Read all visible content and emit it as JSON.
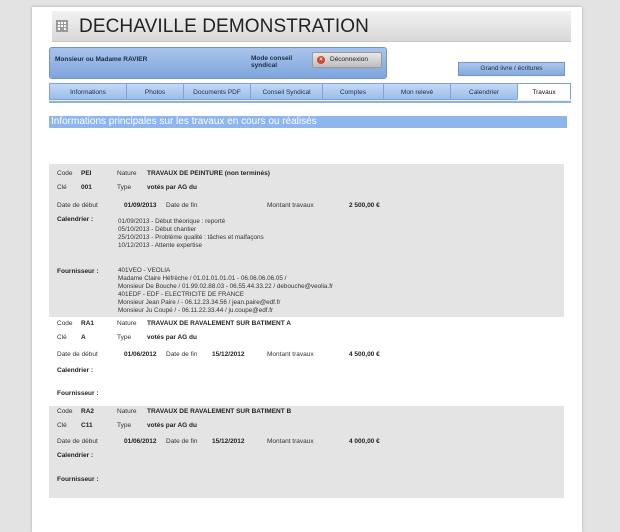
{
  "app_title": "DECHAVILLE DEMONSTRATION",
  "user": {
    "name": "Monsieur ou Madame RAVIER",
    "mode": "Mode conseil syndical",
    "logout_label": "Déconnexion"
  },
  "ledger_button": "Grand livre / écritures",
  "tabs": [
    "Informations",
    "Photos",
    "Documents PDF",
    "Conseil Syndical",
    "Comptes",
    "Mon relevé",
    "Calendrier",
    "Travaux"
  ],
  "active_tab": "Travaux",
  "section_title": "Informations principales sur les travaux en cours ou réalisés",
  "labels": {
    "code": "Code",
    "nature": "Nature",
    "cle": "Clé",
    "type": "Type",
    "date_debut": "Date de début",
    "date_fin": "Date de fin",
    "montant": "Montant travaux",
    "calendrier": "Calendrier :",
    "fournisseur": "Fournisseur :"
  },
  "works": [
    {
      "code": "PEI",
      "nature": "TRAVAUX DE PEINTURE (non terminés)",
      "cle": "001",
      "type": "votés par AG du",
      "date_debut": "01/09/2013",
      "date_fin": "",
      "montant": "2 500,00 €",
      "calendrier": [
        "01/09/2013 - Début théorique : reporté",
        "05/10/2013 - Début chantier",
        "25/10/2013 - Problème qualité : tâches et malfaçons",
        "10/12/2013 - Attente expertise"
      ],
      "fournisseurs": [
        "401VEO - VEOLIA",
        "Madame Claire Héfrèche / 01.01.01.01.01 - 06.06.06.06.05 /",
        "Monsieur De Bouche / 01.99.02.88.03 - 06.55.44.33.22 / debouche@veolia.fr",
        "401EDF - EDF - ELECTRICITE DE FRANCE",
        "Monsieur Jean Paire / - 06.12.23.34.56 / jean.paire@edf.fr",
        "Monsieur Ju Coupé / - 06.11.22.33.44 / ju.coupe@edf.fr"
      ]
    },
    {
      "code": "RA1",
      "nature": "TRAVAUX DE RAVALEMENT SUR BATIMENT A",
      "cle": "A",
      "type": "votés par AG du",
      "date_debut": "01/06/2012",
      "date_fin": "15/12/2012",
      "montant": "4 500,00 €",
      "calendrier": [],
      "fournisseurs": []
    },
    {
      "code": "RA2",
      "nature": "TRAVAUX DE RAVALEMENT SUR BATIMENT B",
      "cle": "C11",
      "type": "votés par AG du",
      "date_debut": "01/06/2012",
      "date_fin": "15/12/2012",
      "montant": "4 000,00 €",
      "calendrier": [],
      "fournisseurs": []
    }
  ]
}
